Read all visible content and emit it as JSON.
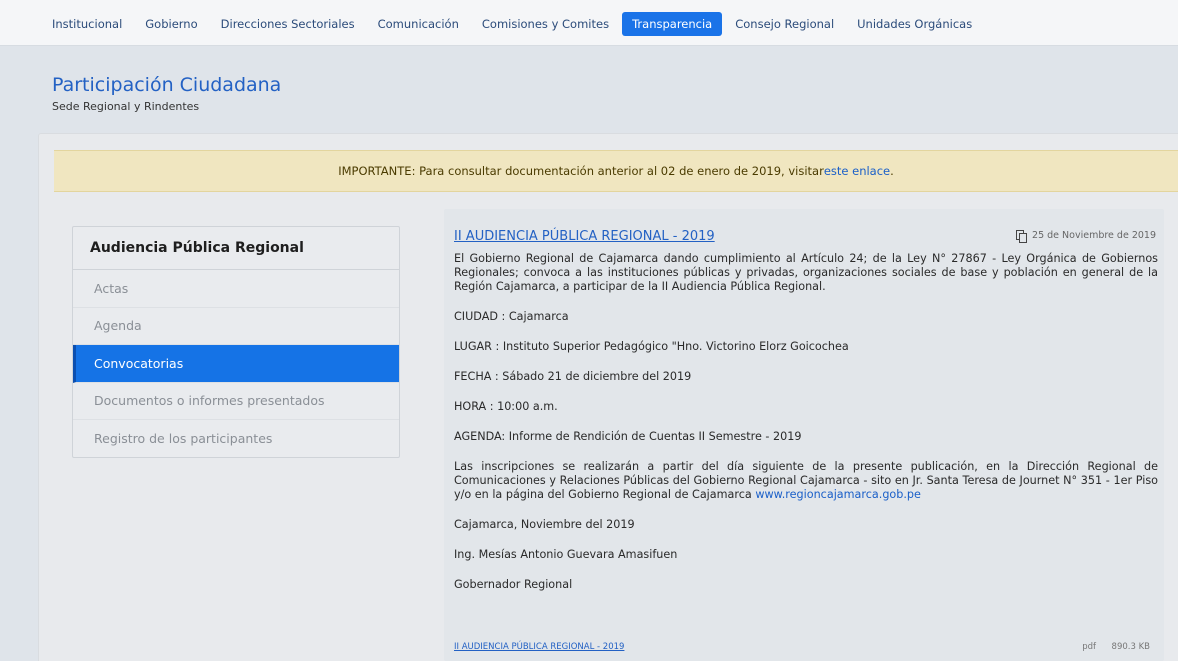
{
  "nav": {
    "items": [
      {
        "label": "Institucional"
      },
      {
        "label": "Gobierno"
      },
      {
        "label": "Direcciones Sectoriales"
      },
      {
        "label": "Comunicación"
      },
      {
        "label": "Comisiones y Comites"
      },
      {
        "label": "Transparencia",
        "active": true
      },
      {
        "label": "Consejo Regional"
      },
      {
        "label": "Unidades Orgánicas"
      }
    ]
  },
  "header": {
    "title": "Participación Ciudadana",
    "subtitle": "Sede Regional y Rindentes"
  },
  "notice": {
    "prefix": "IMPORTANTE",
    "text": " : Para consultar documentación anterior al 02 de enero de 2019, visitar ",
    "link": "este enlace",
    "suffix": "."
  },
  "sidebar": {
    "title": "Audiencia Pública Regional",
    "items": [
      {
        "label": "Actas"
      },
      {
        "label": "Agenda"
      },
      {
        "label": "Convocatorias",
        "active": true
      },
      {
        "label": "Documentos o informes presentados"
      },
      {
        "label": "Registro de los participantes"
      }
    ]
  },
  "article": {
    "title": "II AUDIENCIA PÚBLICA REGIONAL - 2019",
    "date": "25 de Noviembre de 2019",
    "intro": "El Gobierno Regional de Cajamarca dando cumplimiento al Artículo 24; de la Ley N° 27867 - Ley Orgánica de Gobiernos Regionales; convoca a las instituciones públicas y privadas, organizaciones sociales de base y población en general de la Región Cajamarca, a participar de la II Audiencia Pública Regional.",
    "ciudad": "CIUDAD   : Cajamarca",
    "lugar": "LUGAR   : Instituto Superior Pedagógico \"Hno. Victorino Elorz Goicochea",
    "fecha": "FECHA   : Sábado 21 de diciembre del 2019",
    "hora": "HORA   : 10:00 a.m.",
    "agenda": "AGENDA: Informe de Rendición de Cuentas II Semestre - 2019",
    "inscripciones": "Las inscripciones se realizarán a partir del día siguiente de la presente publicación, en la Dirección Regional de Comunicaciones y Relaciones Públicas del Gobierno Regional Cajamarca - sito en Jr. Santa Teresa de Journet N° 351 - 1er Piso y/o en la página del Gobierno Regional de Cajamarca ",
    "web": "www.regioncajamarca.gob.pe",
    "lugar_fecha": "Cajamarca, Noviembre del 2019",
    "firmante": "Ing. Mesías Antonio Guevara Amasifuen",
    "cargo": "Gobernador Regional"
  },
  "attachment": {
    "name": "II AUDIENCIA PÚBLICA REGIONAL - 2019",
    "type": "pdf",
    "size": "890.3 KB"
  },
  "colors": {
    "accent": "#1a73e8",
    "title_blue": "#2361c4",
    "notice_bg": "#f0e6c0"
  }
}
